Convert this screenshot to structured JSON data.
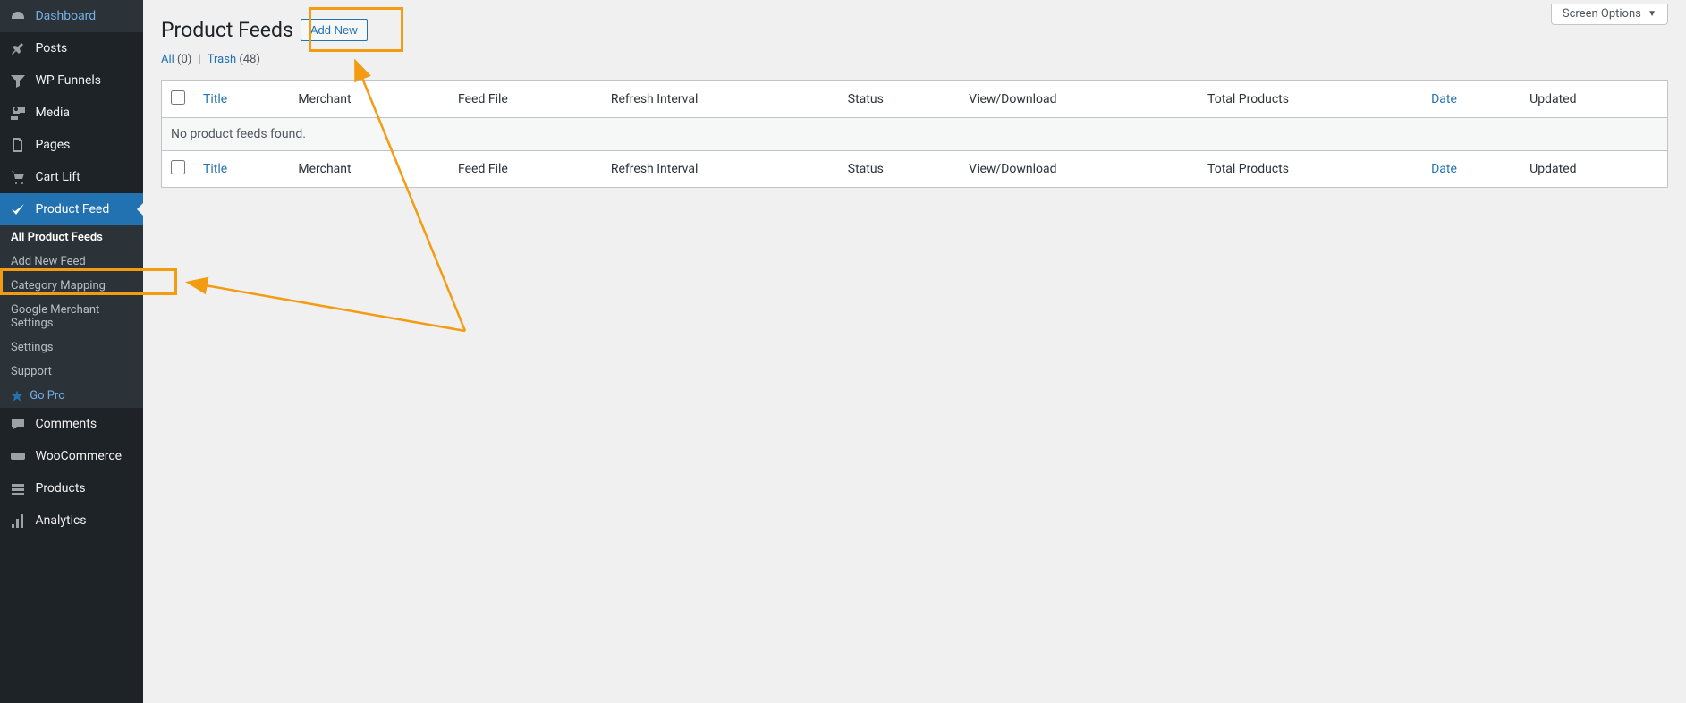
{
  "sidebar": {
    "menu": [
      {
        "key": "dashboard",
        "label": "Dashboard"
      },
      {
        "key": "posts",
        "label": "Posts"
      },
      {
        "key": "wpfunnels",
        "label": "WP Funnels"
      },
      {
        "key": "media",
        "label": "Media"
      },
      {
        "key": "pages",
        "label": "Pages"
      },
      {
        "key": "cartlift",
        "label": "Cart Lift"
      },
      {
        "key": "productfeed",
        "label": "Product Feed",
        "active": true
      },
      {
        "key": "comments",
        "label": "Comments"
      },
      {
        "key": "woocommerce",
        "label": "WooCommerce"
      },
      {
        "key": "products",
        "label": "Products"
      },
      {
        "key": "analytics",
        "label": "Analytics"
      }
    ],
    "submenu": [
      {
        "key": "all-feeds",
        "label": "All Product Feeds",
        "current": true
      },
      {
        "key": "add-new-feed",
        "label": "Add New Feed"
      },
      {
        "key": "category-mapping",
        "label": "Category Mapping"
      },
      {
        "key": "google-merchant",
        "label": "Google Merchant Settings"
      },
      {
        "key": "settings",
        "label": "Settings"
      },
      {
        "key": "support",
        "label": "Support"
      },
      {
        "key": "gopro",
        "label": "Go Pro"
      }
    ]
  },
  "header": {
    "title": "Product Feeds",
    "add_new": "Add New",
    "screen_options": "Screen Options"
  },
  "filters": {
    "all_label": "All",
    "all_count": "(0)",
    "trash_label": "Trash",
    "trash_count": "(48)"
  },
  "table": {
    "columns": {
      "title": "Title",
      "merchant": "Merchant",
      "feed_file": "Feed File",
      "refresh_interval": "Refresh Interval",
      "status": "Status",
      "view_download": "View/Download",
      "total_products": "Total Products",
      "date": "Date",
      "updated": "Updated"
    },
    "empty_msg": "No product feeds found."
  }
}
